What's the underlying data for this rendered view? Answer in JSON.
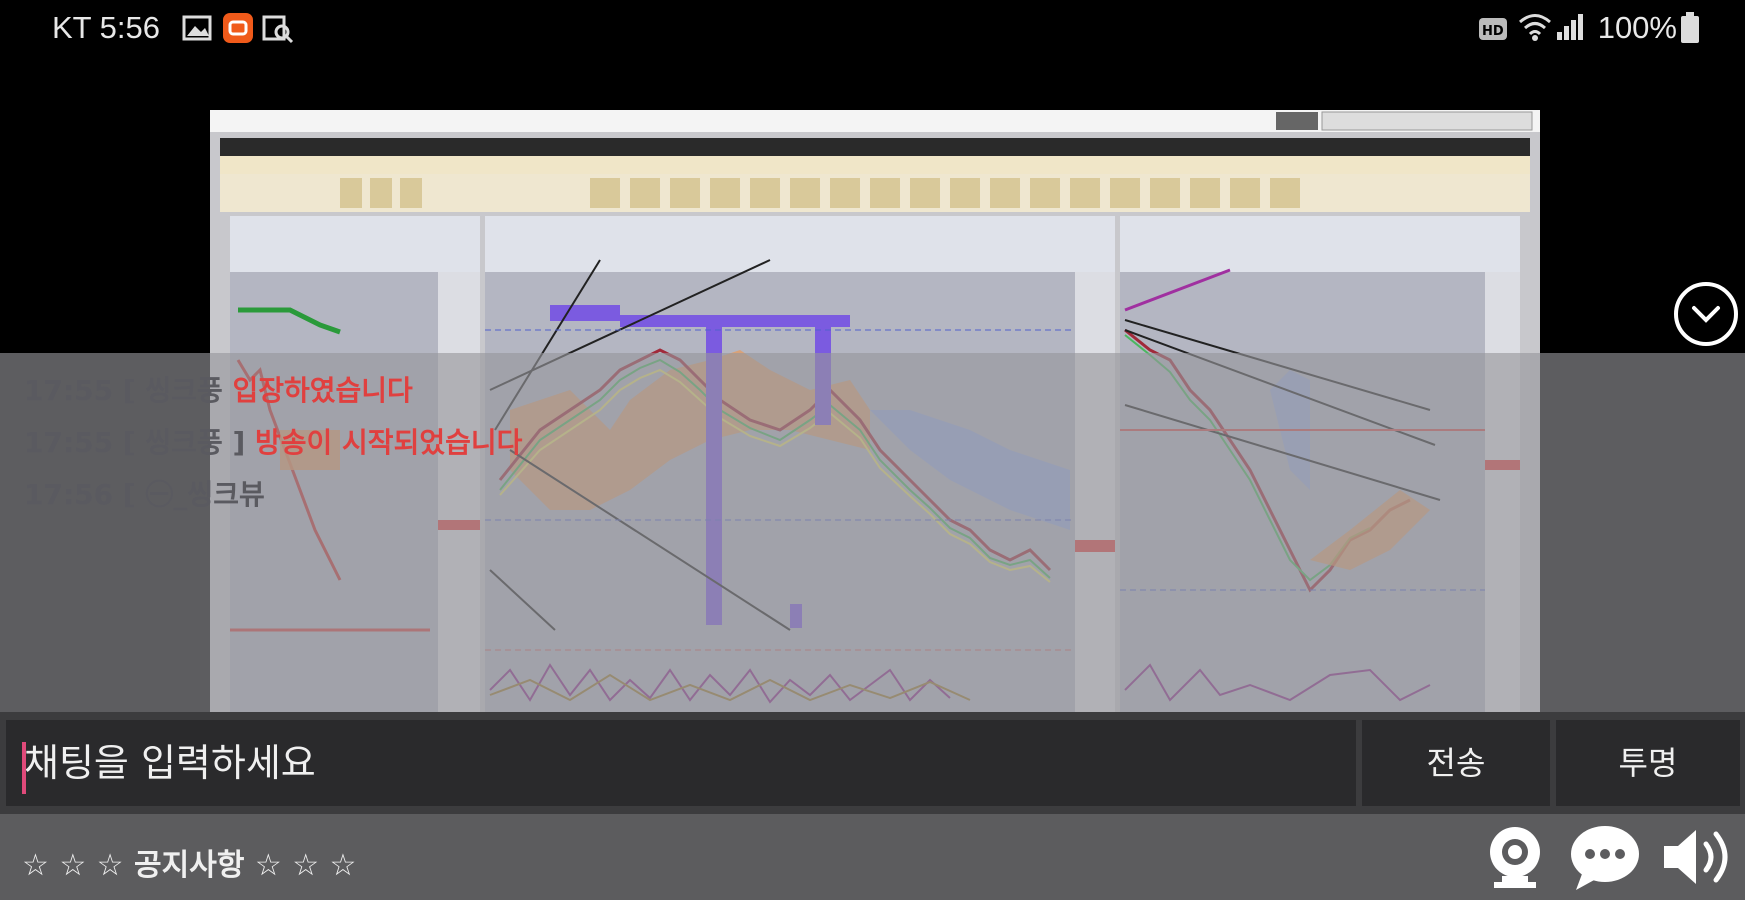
{
  "status_bar": {
    "carrier_time": "KT 5:56",
    "battery": "100%",
    "icons": [
      "gallery-icon",
      "app-notification-icon",
      "search-doc-icon",
      "hd-icon",
      "wifi-icon",
      "signal-icon",
      "battery-icon"
    ]
  },
  "screen_share": {
    "description_icon": "trading-chart-screen"
  },
  "chat": {
    "messages": [
      {
        "time": "17:55",
        "text": "[ 씽크풍",
        "tail": "입장하였습니다"
      },
      {
        "time": "17:55",
        "text": "[ 씽크풍 ]",
        "tail": "방송이 시작되었습니다"
      },
      {
        "time": "17:56",
        "text": "[ ㊀_씽크뷰",
        "tail": ""
      }
    ]
  },
  "input_bar": {
    "placeholder": "채팅을 입력하세요",
    "send_label": "전송",
    "transparent_label": "투명"
  },
  "notice": {
    "text": "☆ ☆ ☆ 공지사항 ☆ ☆ ☆"
  },
  "colors": {
    "accent_caret": "#e04a7a",
    "chat_red": "#e0403f",
    "purple_marker": "#7b5be0"
  }
}
